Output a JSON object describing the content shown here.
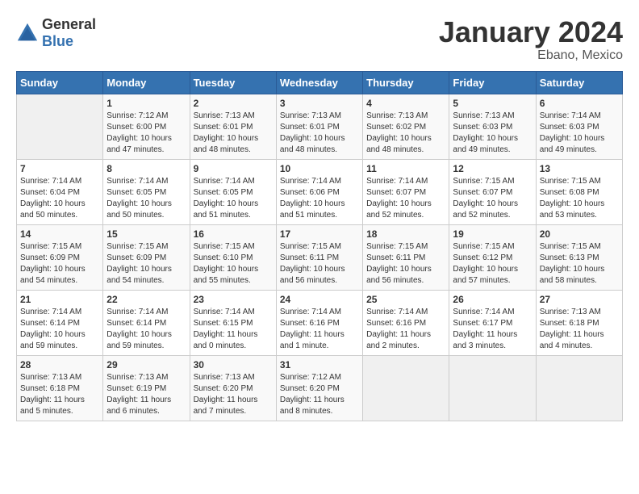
{
  "logo": {
    "text_general": "General",
    "text_blue": "Blue"
  },
  "title": "January 2024",
  "subtitle": "Ebano, Mexico",
  "headers": [
    "Sunday",
    "Monday",
    "Tuesday",
    "Wednesday",
    "Thursday",
    "Friday",
    "Saturday"
  ],
  "weeks": [
    [
      {
        "day": "",
        "info": ""
      },
      {
        "day": "1",
        "info": "Sunrise: 7:12 AM\nSunset: 6:00 PM\nDaylight: 10 hours\nand 47 minutes."
      },
      {
        "day": "2",
        "info": "Sunrise: 7:13 AM\nSunset: 6:01 PM\nDaylight: 10 hours\nand 48 minutes."
      },
      {
        "day": "3",
        "info": "Sunrise: 7:13 AM\nSunset: 6:01 PM\nDaylight: 10 hours\nand 48 minutes."
      },
      {
        "day": "4",
        "info": "Sunrise: 7:13 AM\nSunset: 6:02 PM\nDaylight: 10 hours\nand 48 minutes."
      },
      {
        "day": "5",
        "info": "Sunrise: 7:13 AM\nSunset: 6:03 PM\nDaylight: 10 hours\nand 49 minutes."
      },
      {
        "day": "6",
        "info": "Sunrise: 7:14 AM\nSunset: 6:03 PM\nDaylight: 10 hours\nand 49 minutes."
      }
    ],
    [
      {
        "day": "7",
        "info": "Sunrise: 7:14 AM\nSunset: 6:04 PM\nDaylight: 10 hours\nand 50 minutes."
      },
      {
        "day": "8",
        "info": "Sunrise: 7:14 AM\nSunset: 6:05 PM\nDaylight: 10 hours\nand 50 minutes."
      },
      {
        "day": "9",
        "info": "Sunrise: 7:14 AM\nSunset: 6:05 PM\nDaylight: 10 hours\nand 51 minutes."
      },
      {
        "day": "10",
        "info": "Sunrise: 7:14 AM\nSunset: 6:06 PM\nDaylight: 10 hours\nand 51 minutes."
      },
      {
        "day": "11",
        "info": "Sunrise: 7:14 AM\nSunset: 6:07 PM\nDaylight: 10 hours\nand 52 minutes."
      },
      {
        "day": "12",
        "info": "Sunrise: 7:15 AM\nSunset: 6:07 PM\nDaylight: 10 hours\nand 52 minutes."
      },
      {
        "day": "13",
        "info": "Sunrise: 7:15 AM\nSunset: 6:08 PM\nDaylight: 10 hours\nand 53 minutes."
      }
    ],
    [
      {
        "day": "14",
        "info": "Sunrise: 7:15 AM\nSunset: 6:09 PM\nDaylight: 10 hours\nand 54 minutes."
      },
      {
        "day": "15",
        "info": "Sunrise: 7:15 AM\nSunset: 6:09 PM\nDaylight: 10 hours\nand 54 minutes."
      },
      {
        "day": "16",
        "info": "Sunrise: 7:15 AM\nSunset: 6:10 PM\nDaylight: 10 hours\nand 55 minutes."
      },
      {
        "day": "17",
        "info": "Sunrise: 7:15 AM\nSunset: 6:11 PM\nDaylight: 10 hours\nand 56 minutes."
      },
      {
        "day": "18",
        "info": "Sunrise: 7:15 AM\nSunset: 6:11 PM\nDaylight: 10 hours\nand 56 minutes."
      },
      {
        "day": "19",
        "info": "Sunrise: 7:15 AM\nSunset: 6:12 PM\nDaylight: 10 hours\nand 57 minutes."
      },
      {
        "day": "20",
        "info": "Sunrise: 7:15 AM\nSunset: 6:13 PM\nDaylight: 10 hours\nand 58 minutes."
      }
    ],
    [
      {
        "day": "21",
        "info": "Sunrise: 7:14 AM\nSunset: 6:14 PM\nDaylight: 10 hours\nand 59 minutes."
      },
      {
        "day": "22",
        "info": "Sunrise: 7:14 AM\nSunset: 6:14 PM\nDaylight: 10 hours\nand 59 minutes."
      },
      {
        "day": "23",
        "info": "Sunrise: 7:14 AM\nSunset: 6:15 PM\nDaylight: 11 hours\nand 0 minutes."
      },
      {
        "day": "24",
        "info": "Sunrise: 7:14 AM\nSunset: 6:16 PM\nDaylight: 11 hours\nand 1 minute."
      },
      {
        "day": "25",
        "info": "Sunrise: 7:14 AM\nSunset: 6:16 PM\nDaylight: 11 hours\nand 2 minutes."
      },
      {
        "day": "26",
        "info": "Sunrise: 7:14 AM\nSunset: 6:17 PM\nDaylight: 11 hours\nand 3 minutes."
      },
      {
        "day": "27",
        "info": "Sunrise: 7:13 AM\nSunset: 6:18 PM\nDaylight: 11 hours\nand 4 minutes."
      }
    ],
    [
      {
        "day": "28",
        "info": "Sunrise: 7:13 AM\nSunset: 6:18 PM\nDaylight: 11 hours\nand 5 minutes."
      },
      {
        "day": "29",
        "info": "Sunrise: 7:13 AM\nSunset: 6:19 PM\nDaylight: 11 hours\nand 6 minutes."
      },
      {
        "day": "30",
        "info": "Sunrise: 7:13 AM\nSunset: 6:20 PM\nDaylight: 11 hours\nand 7 minutes."
      },
      {
        "day": "31",
        "info": "Sunrise: 7:12 AM\nSunset: 6:20 PM\nDaylight: 11 hours\nand 8 minutes."
      },
      {
        "day": "",
        "info": ""
      },
      {
        "day": "",
        "info": ""
      },
      {
        "day": "",
        "info": ""
      }
    ]
  ]
}
